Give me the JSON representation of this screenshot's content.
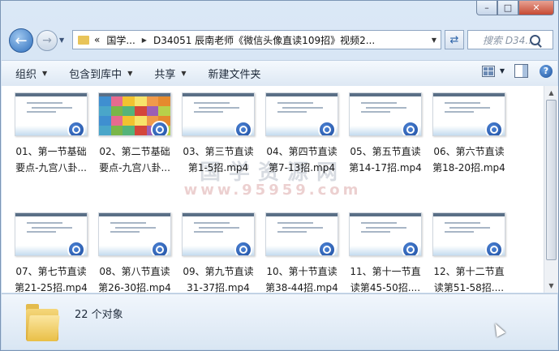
{
  "window": {
    "buttons": {
      "minimize": "–",
      "maximize": "□",
      "close": "✕"
    }
  },
  "address": {
    "segments": [
      "«",
      "国学...",
      "D34051 辰南老师《微信头像直读109招》视频2..."
    ],
    "refresh_icon": "refresh-icon"
  },
  "search": {
    "placeholder": "搜索 D34..."
  },
  "toolbar": {
    "organize": "组织",
    "include_in_library": "包含到库中",
    "share": "共享",
    "new_folder": "新建文件夹"
  },
  "watermark": {
    "line1": "国学资源网",
    "line2": "www.95959.com"
  },
  "files": [
    {
      "line1": "01、第一节基础",
      "line2": "要点-九宫八卦..."
    },
    {
      "line1": "02、第二节基础",
      "line2": "要点-九宫八卦..."
    },
    {
      "line1": "03、第三节直读",
      "line2": "第1-5招.mp4"
    },
    {
      "line1": "04、第四节直读",
      "line2": "第7-13招.mp4"
    },
    {
      "line1": "05、第五节直读",
      "line2": "第14-17招.mp4"
    },
    {
      "line1": "06、第六节直读",
      "line2": "第18-20招.mp4"
    },
    {
      "line1": "07、第七节直读",
      "line2": "第21-25招.mp4"
    },
    {
      "line1": "08、第八节直读",
      "line2": "第26-30招.mp4"
    },
    {
      "line1": "09、第九节直读",
      "line2": "31-37招.mp4"
    },
    {
      "line1": "10、第十节直读",
      "line2": "第38-44招.mp4"
    },
    {
      "line1": "11、第十一节直",
      "line2": "读第45-50招...."
    },
    {
      "line1": "12、第十二节直",
      "line2": "读第51-58招...."
    }
  ],
  "status": {
    "count": "22 个对象"
  }
}
